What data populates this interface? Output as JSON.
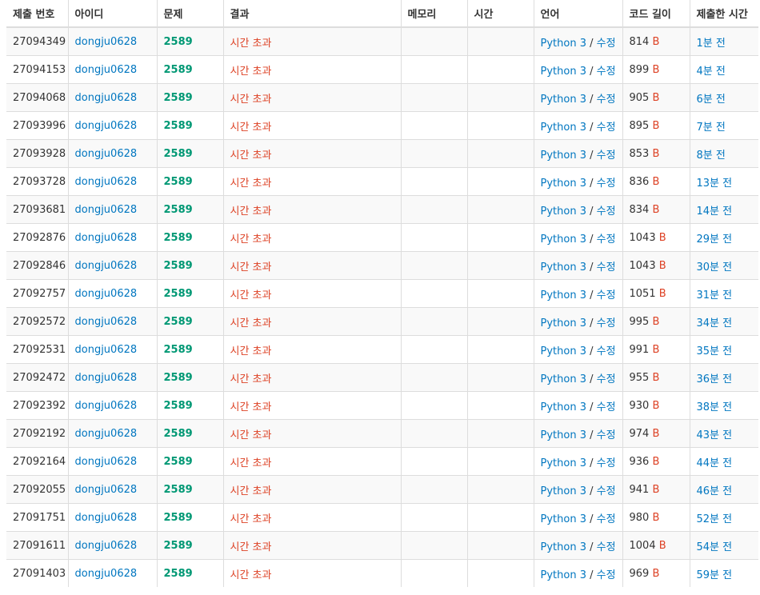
{
  "colors": {
    "link": "#0076c0",
    "problem": "#009874",
    "result": "#dd4124",
    "text": "#333333",
    "stripe": "#f9f9f9",
    "border": "#dddddd"
  },
  "headers": [
    "제출 번호",
    "아이디",
    "문제",
    "결과",
    "메모리",
    "시간",
    "언어",
    "코드 길이",
    "제출한 시간"
  ],
  "rows": [
    {
      "id": "27094349",
      "user": "dongju0628",
      "problem": "2589",
      "result": "시간 초과",
      "memory": "",
      "time": "",
      "lang": "Python 3",
      "sep": "/",
      "edit": "수정",
      "length": "814",
      "unit": "B",
      "submitted": "1분 전"
    },
    {
      "id": "27094153",
      "user": "dongju0628",
      "problem": "2589",
      "result": "시간 초과",
      "memory": "",
      "time": "",
      "lang": "Python 3",
      "sep": "/",
      "edit": "수정",
      "length": "899",
      "unit": "B",
      "submitted": "4분 전"
    },
    {
      "id": "27094068",
      "user": "dongju0628",
      "problem": "2589",
      "result": "시간 초과",
      "memory": "",
      "time": "",
      "lang": "Python 3",
      "sep": "/",
      "edit": "수정",
      "length": "905",
      "unit": "B",
      "submitted": "6분 전"
    },
    {
      "id": "27093996",
      "user": "dongju0628",
      "problem": "2589",
      "result": "시간 초과",
      "memory": "",
      "time": "",
      "lang": "Python 3",
      "sep": "/",
      "edit": "수정",
      "length": "895",
      "unit": "B",
      "submitted": "7분 전"
    },
    {
      "id": "27093928",
      "user": "dongju0628",
      "problem": "2589",
      "result": "시간 초과",
      "memory": "",
      "time": "",
      "lang": "Python 3",
      "sep": "/",
      "edit": "수정",
      "length": "853",
      "unit": "B",
      "submitted": "8분 전"
    },
    {
      "id": "27093728",
      "user": "dongju0628",
      "problem": "2589",
      "result": "시간 초과",
      "memory": "",
      "time": "",
      "lang": "Python 3",
      "sep": "/",
      "edit": "수정",
      "length": "836",
      "unit": "B",
      "submitted": "13분 전"
    },
    {
      "id": "27093681",
      "user": "dongju0628",
      "problem": "2589",
      "result": "시간 초과",
      "memory": "",
      "time": "",
      "lang": "Python 3",
      "sep": "/",
      "edit": "수정",
      "length": "834",
      "unit": "B",
      "submitted": "14분 전"
    },
    {
      "id": "27092876",
      "user": "dongju0628",
      "problem": "2589",
      "result": "시간 초과",
      "memory": "",
      "time": "",
      "lang": "Python 3",
      "sep": "/",
      "edit": "수정",
      "length": "1043",
      "unit": "B",
      "submitted": "29분 전"
    },
    {
      "id": "27092846",
      "user": "dongju0628",
      "problem": "2589",
      "result": "시간 초과",
      "memory": "",
      "time": "",
      "lang": "Python 3",
      "sep": "/",
      "edit": "수정",
      "length": "1043",
      "unit": "B",
      "submitted": "30분 전"
    },
    {
      "id": "27092757",
      "user": "dongju0628",
      "problem": "2589",
      "result": "시간 초과",
      "memory": "",
      "time": "",
      "lang": "Python 3",
      "sep": "/",
      "edit": "수정",
      "length": "1051",
      "unit": "B",
      "submitted": "31분 전"
    },
    {
      "id": "27092572",
      "user": "dongju0628",
      "problem": "2589",
      "result": "시간 초과",
      "memory": "",
      "time": "",
      "lang": "Python 3",
      "sep": "/",
      "edit": "수정",
      "length": "995",
      "unit": "B",
      "submitted": "34분 전"
    },
    {
      "id": "27092531",
      "user": "dongju0628",
      "problem": "2589",
      "result": "시간 초과",
      "memory": "",
      "time": "",
      "lang": "Python 3",
      "sep": "/",
      "edit": "수정",
      "length": "991",
      "unit": "B",
      "submitted": "35분 전"
    },
    {
      "id": "27092472",
      "user": "dongju0628",
      "problem": "2589",
      "result": "시간 초과",
      "memory": "",
      "time": "",
      "lang": "Python 3",
      "sep": "/",
      "edit": "수정",
      "length": "955",
      "unit": "B",
      "submitted": "36분 전"
    },
    {
      "id": "27092392",
      "user": "dongju0628",
      "problem": "2589",
      "result": "시간 초과",
      "memory": "",
      "time": "",
      "lang": "Python 3",
      "sep": "/",
      "edit": "수정",
      "length": "930",
      "unit": "B",
      "submitted": "38분 전"
    },
    {
      "id": "27092192",
      "user": "dongju0628",
      "problem": "2589",
      "result": "시간 초과",
      "memory": "",
      "time": "",
      "lang": "Python 3",
      "sep": "/",
      "edit": "수정",
      "length": "974",
      "unit": "B",
      "submitted": "43분 전"
    },
    {
      "id": "27092164",
      "user": "dongju0628",
      "problem": "2589",
      "result": "시간 초과",
      "memory": "",
      "time": "",
      "lang": "Python 3",
      "sep": "/",
      "edit": "수정",
      "length": "936",
      "unit": "B",
      "submitted": "44분 전"
    },
    {
      "id": "27092055",
      "user": "dongju0628",
      "problem": "2589",
      "result": "시간 초과",
      "memory": "",
      "time": "",
      "lang": "Python 3",
      "sep": "/",
      "edit": "수정",
      "length": "941",
      "unit": "B",
      "submitted": "46분 전"
    },
    {
      "id": "27091751",
      "user": "dongju0628",
      "problem": "2589",
      "result": "시간 초과",
      "memory": "",
      "time": "",
      "lang": "Python 3",
      "sep": "/",
      "edit": "수정",
      "length": "980",
      "unit": "B",
      "submitted": "52분 전"
    },
    {
      "id": "27091611",
      "user": "dongju0628",
      "problem": "2589",
      "result": "시간 초과",
      "memory": "",
      "time": "",
      "lang": "Python 3",
      "sep": "/",
      "edit": "수정",
      "length": "1004",
      "unit": "B",
      "submitted": "54분 전"
    },
    {
      "id": "27091403",
      "user": "dongju0628",
      "problem": "2589",
      "result": "시간 초과",
      "memory": "",
      "time": "",
      "lang": "Python 3",
      "sep": "/",
      "edit": "수정",
      "length": "969",
      "unit": "B",
      "submitted": "59분 전"
    }
  ]
}
